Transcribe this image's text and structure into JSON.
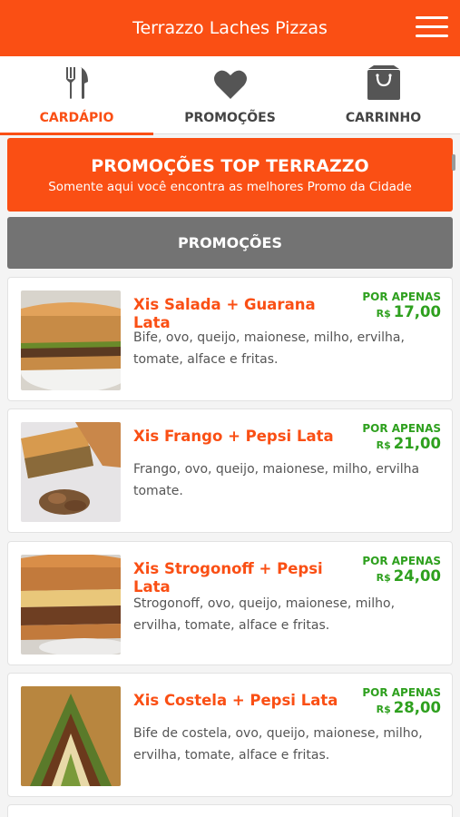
{
  "header": {
    "title": "Terrazzo Laches Pizzas",
    "menu_icon": "hamburger-menu-icon"
  },
  "tabs": [
    {
      "label": "CARDÁPIO",
      "icon": "fork-knife-icon",
      "active": true
    },
    {
      "label": "PROMOÇÕES",
      "icon": "heart-icon",
      "active": false
    },
    {
      "label": "CARRINHO",
      "icon": "shopping-bag-icon",
      "active": false
    }
  ],
  "banner": {
    "title": "PROMOÇÕES TOP TERRAZZO",
    "subtitle": "Somente aqui você encontra as melhores Promo da Cidade"
  },
  "section": {
    "title": "PROMOÇÕES"
  },
  "products": [
    {
      "name": "Xis Salada + Guarana Lata",
      "price_label": "POR APENAS",
      "currency": "R$",
      "price": "17,00",
      "description": "Bife, ovo, queijo, maionese, milho, ervilha, tomate, alface e fritas."
    },
    {
      "name": "Xis Frango + Pepsi Lata",
      "price_label": "POR APENAS",
      "currency": "R$",
      "price": "21,00",
      "description": "Frango, ovo, queijo, maionese, milho, ervilha tomate."
    },
    {
      "name": "Xis Strogonoff + Pepsi Lata",
      "price_label": "POR APENAS",
      "currency": "R$",
      "price": "24,00",
      "description": "Strogonoff, ovo, queijo, maionese, milho, ervilha, tomate, alface e fritas."
    },
    {
      "name": "Xis Costela + Pepsi Lata",
      "price_label": "POR APENAS",
      "currency": "R$",
      "price": "28,00",
      "description": "Bife de costela, ovo, queijo, maionese, milho, ervilha, tomate, alface e fritas."
    }
  ],
  "colors": {
    "brand": "#fa4f14",
    "price": "#2ea01e",
    "section": "#737373"
  }
}
